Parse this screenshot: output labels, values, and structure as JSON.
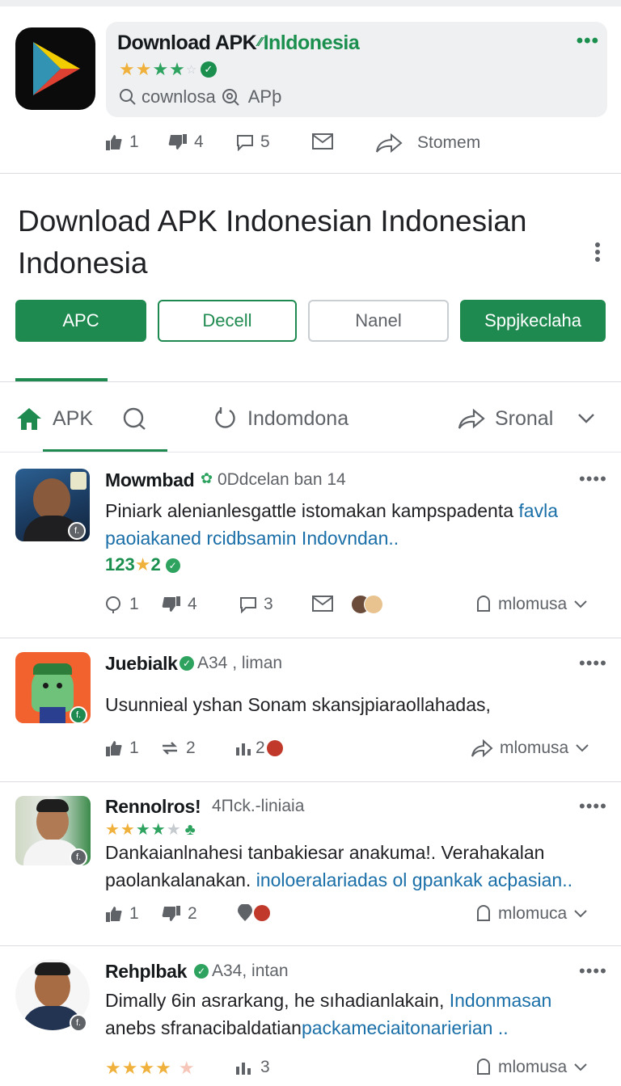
{
  "header": {
    "title_part1": "Download APK",
    "title_mark": "⁄⁄",
    "title_part2": "Inldonesia",
    "menu": "•••",
    "rating_stars": "★★★★☆",
    "search_text": "cownlosa",
    "search_suffix": "APþ",
    "actions": {
      "like": "1",
      "dislike": "4",
      "comment": "5",
      "share": "Stomem"
    }
  },
  "page": {
    "title": "Download APK Indonesian Indonesian Indonesia",
    "pills": [
      "APC",
      "Decell",
      "Nanel",
      "Sppjkeclaha"
    ]
  },
  "tabs": {
    "apk": "APK",
    "indo": "Indomdona",
    "share": "Sronal"
  },
  "posts": [
    {
      "name": "Mowmbad",
      "meta": "0Ddcelan ban 14",
      "text": "Piniark alenianlesgattle istomakan kampspadenta",
      "link1": "favla",
      "link2": "paoiakaned rcidbsamin Indovndan..",
      "stats_a": "123",
      "stats_b": "2",
      "actions": {
        "like": "1",
        "dislike": "4",
        "comment": "3",
        "more": "mlomusa"
      }
    },
    {
      "name": "Juebialk",
      "meta": "A34 , liman",
      "text": "Usunnieal yshan Sonam skansjpiaraollahadas,",
      "actions": {
        "like": "1",
        "repost": "2",
        "count": "2",
        "more": "mlomusa"
      }
    },
    {
      "name": "Rennolros!",
      "meta": "4Πck.-liniaia",
      "rating": "★★★★",
      "text": "Dankaianlnahesi tanbakiesar anakuma!. Verahakalan paolankalanakan.",
      "link": "inoloeralariadas ol gpankak acþasian..",
      "actions": {
        "like": "1",
        "dislike": "2",
        "more": "mlomuca"
      }
    },
    {
      "name": "Rehplbak",
      "meta": "A34, intan",
      "text": "Dimally 6in asrarkang, he sıhadianlakain,",
      "link1": "Indonmasan",
      "text2": "anebs sfranacibaldatian",
      "link2": "packameciaitonarierian ..",
      "rating": "★★★★",
      "actions": {
        "repost": "3",
        "more": "mlomusa"
      }
    }
  ]
}
